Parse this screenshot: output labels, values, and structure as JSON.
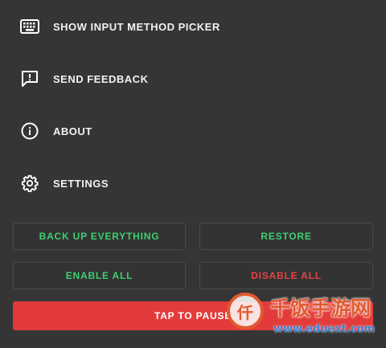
{
  "menu": {
    "items": [
      {
        "label": "SHOW INPUT METHOD PICKER",
        "icon": "keyboard-icon"
      },
      {
        "label": "SEND FEEDBACK",
        "icon": "feedback-icon"
      },
      {
        "label": "ABOUT",
        "icon": "info-icon"
      },
      {
        "label": "SETTINGS",
        "icon": "gear-icon"
      }
    ]
  },
  "buttons": {
    "backup": "BACK UP EVERYTHING",
    "restore": "RESTORE",
    "enable_all": "ENABLE ALL",
    "disable_all": "DISABLE ALL",
    "tap_to_pause": "TAP TO PAUSE"
  },
  "watermark": {
    "title": "千饭手游网",
    "url": "www.eduext.com"
  },
  "colors": {
    "background": "#353535",
    "accent_green": "#3ecf72",
    "accent_red": "#e94343",
    "pause_button": "#e33b3b"
  }
}
